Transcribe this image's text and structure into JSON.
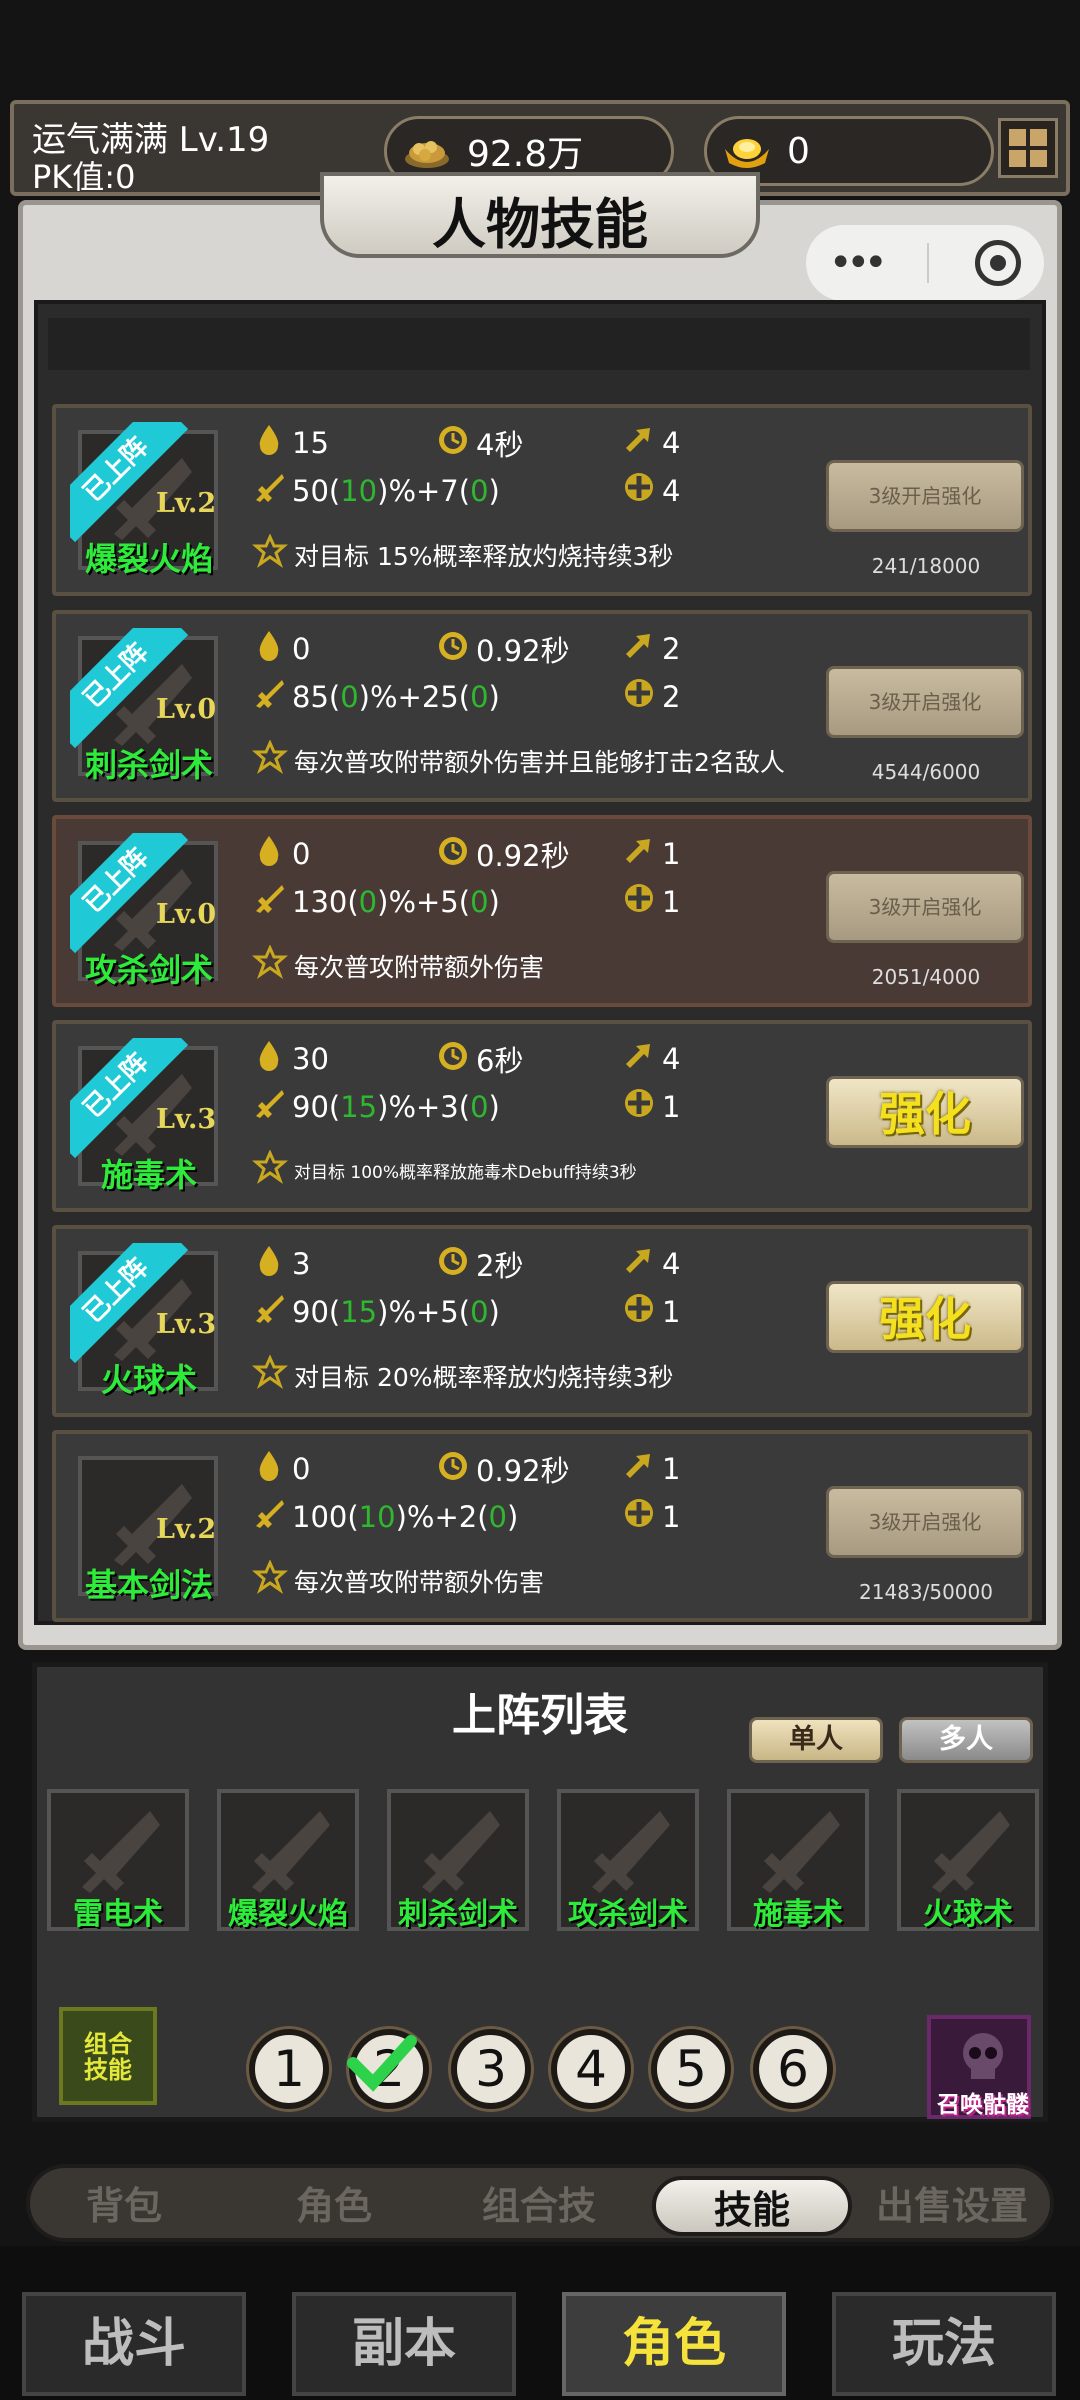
{
  "header": {
    "player_name": "运气满满   Lv.19",
    "pk": "PK值:0",
    "coins": "92.8万",
    "gold": "0"
  },
  "panel": {
    "title": "人物技能"
  },
  "skills": [
    {
      "badge": "已上阵",
      "level": "Lv.2",
      "name": "爆裂火焰",
      "cost": "15",
      "cooldown": "4秒",
      "targets": "4",
      "dmg_base": "50(",
      "dmg_bonus": "10",
      "dmg_tail": ")%+7(",
      "dmg_flat": "0",
      "dmg_end": ")",
      "range": "4",
      "desc": "对目标 15%概率释放灼烧持续3秒",
      "button": "3级开启强化",
      "progress": "241/18000"
    },
    {
      "badge": "已上阵",
      "level": "Lv.0",
      "name": "刺杀剑术",
      "cost": "0",
      "cooldown": "0.92秒",
      "targets": "2",
      "dmg_base": "85(",
      "dmg_bonus": "0",
      "dmg_tail": ")%+25(",
      "dmg_flat": "0",
      "dmg_end": ")",
      "range": "2",
      "desc": "每次普攻附带额外伤害并且能够打击2名敌人",
      "button": "3级开启强化",
      "progress": "4544/6000"
    },
    {
      "badge": "已上阵",
      "level": "Lv.0",
      "name": "攻杀剑术",
      "cost": "0",
      "cooldown": "0.92秒",
      "targets": "1",
      "dmg_base": "130(",
      "dmg_bonus": "0",
      "dmg_tail": ")%+5(",
      "dmg_flat": "0",
      "dmg_end": ")",
      "range": "1",
      "desc": "每次普攻附带额外伤害",
      "button": "3级开启强化",
      "progress": "2051/4000"
    },
    {
      "badge": "已上阵",
      "level": "Lv.3",
      "name": "施毒术",
      "cost": "30",
      "cooldown": "6秒",
      "targets": "4",
      "dmg_base": "90(",
      "dmg_bonus": "15",
      "dmg_tail": ")%+3(",
      "dmg_flat": "0",
      "dmg_end": ")",
      "range": "1",
      "desc": "对目标 100%概率释放施毒术Debuff持续3秒",
      "button": "强化",
      "progress": ""
    },
    {
      "badge": "已上阵",
      "level": "Lv.3",
      "name": "火球术",
      "cost": "3",
      "cooldown": "2秒",
      "targets": "4",
      "dmg_base": "90(",
      "dmg_bonus": "15",
      "dmg_tail": ")%+5(",
      "dmg_flat": "0",
      "dmg_end": ")",
      "range": "1",
      "desc": "对目标 20%概率释放灼烧持续3秒",
      "button": "强化",
      "progress": ""
    },
    {
      "badge": "",
      "level": "Lv.2",
      "name": "基本剑法",
      "cost": "0",
      "cooldown": "0.92秒",
      "targets": "1",
      "dmg_base": "100(",
      "dmg_bonus": "10",
      "dmg_tail": ")%+2(",
      "dmg_flat": "0",
      "dmg_end": ")",
      "range": "1",
      "desc": "每次普攻附带额外伤害",
      "button": "3级开启强化",
      "progress": "21483/50000"
    }
  ],
  "lineup": {
    "title": "上阵列表",
    "mode_single": "单人",
    "mode_multi": "多人",
    "slots": [
      "雷电术",
      "爆裂火焰",
      "刺杀剑术",
      "攻杀剑术",
      "施毒术",
      "火球术"
    ],
    "combo_label": "组合\n技能",
    "numbers": [
      "1",
      "2",
      "3",
      "4",
      "5",
      "6"
    ],
    "summon": "召唤骷髅"
  },
  "subtabs": [
    "背包",
    "角色",
    "组合技",
    "技能",
    "出售设置"
  ],
  "nav": [
    "战斗",
    "副本",
    "角色",
    "玩法"
  ],
  "colors": {
    "skill_name": "#2eea3a",
    "badge": "#1fc9d6",
    "strengthen": "#f5e020",
    "active_nav": "#f5e23a"
  }
}
